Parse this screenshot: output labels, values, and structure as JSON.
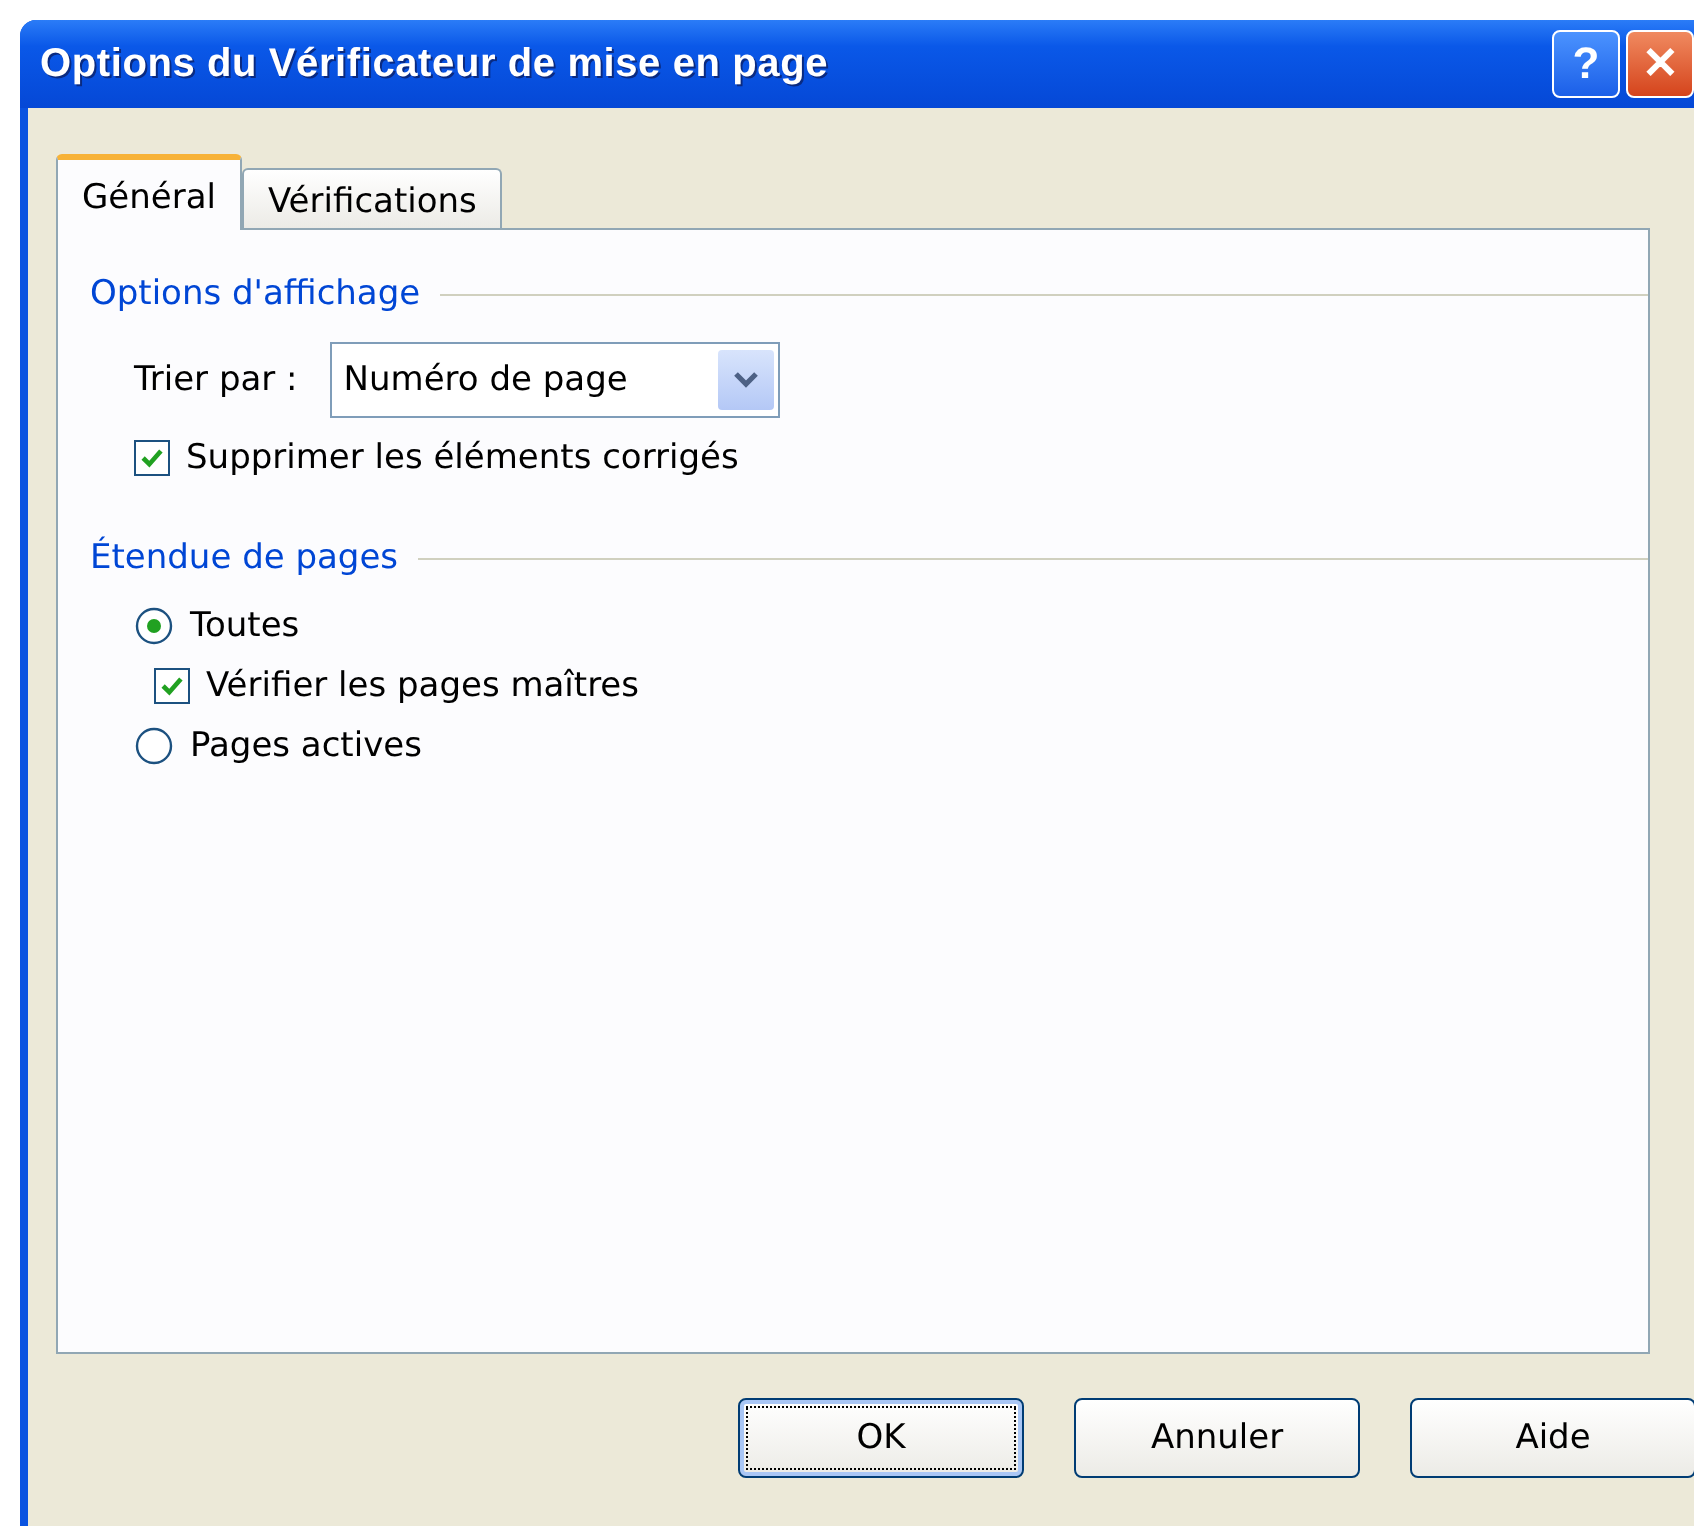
{
  "window": {
    "title": "Options du Vérificateur de mise en page",
    "help": "?",
    "close": "✕"
  },
  "tabs": [
    {
      "label": "Général",
      "selected": true
    },
    {
      "label": "Vérifications",
      "selected": false
    }
  ],
  "sections": [
    {
      "title": "Options d'affichage",
      "items": [
        {
          "kind": "select",
          "label": "Trier par :",
          "value": "Numéro de page"
        },
        {
          "kind": "checkbox",
          "label": "Supprimer les éléments corrigés",
          "checked": true
        }
      ]
    },
    {
      "title": "Étendue de pages",
      "items": [
        {
          "kind": "radio",
          "label": "Toutes",
          "selected": true,
          "children": [
            {
              "kind": "checkbox",
              "label": "Vérifier les pages maîtres",
              "checked": true
            }
          ]
        },
        {
          "kind": "radio",
          "label": "Pages actives",
          "selected": false
        }
      ]
    }
  ],
  "buttons": [
    {
      "label": "OK",
      "focused": true
    },
    {
      "label": "Annuler",
      "focused": false
    },
    {
      "label": "Aide",
      "focused": false
    }
  ]
}
